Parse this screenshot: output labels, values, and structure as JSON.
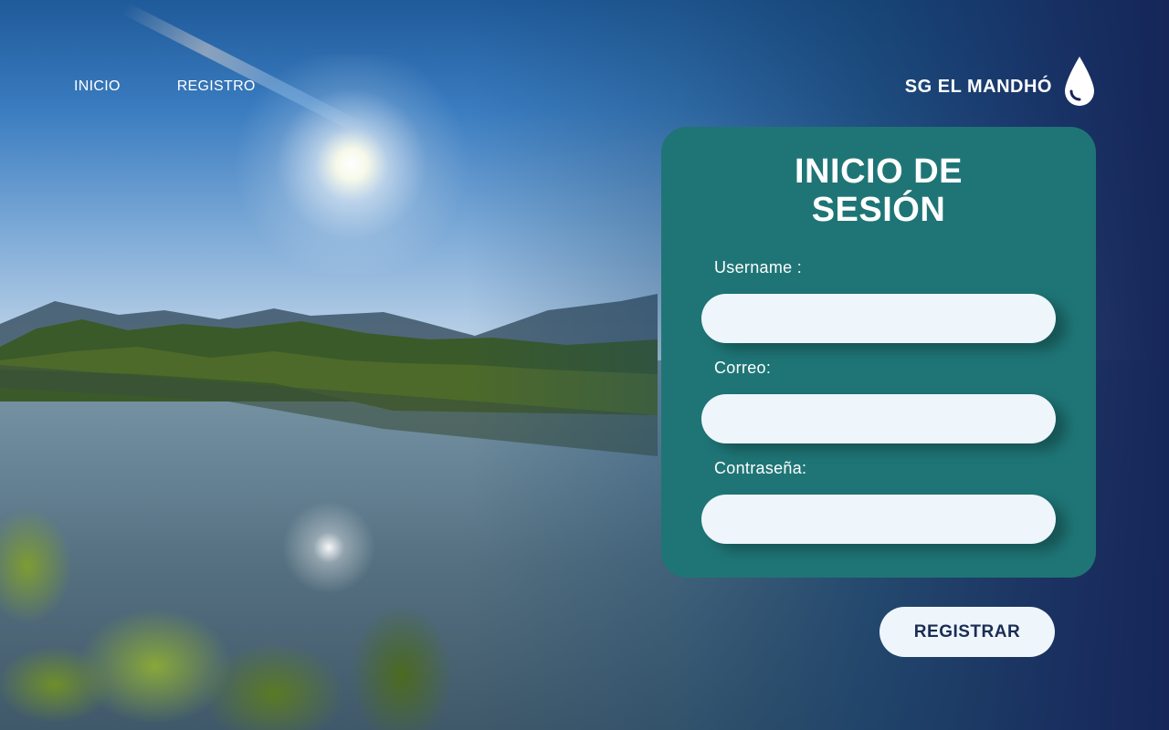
{
  "nav": {
    "items": [
      {
        "label": "INICIO"
      },
      {
        "label": "REGISTRO"
      }
    ]
  },
  "brand": {
    "name": "SG EL MANDHÓ",
    "icon": "water-drop-icon"
  },
  "form": {
    "title_line1": "INICIO DE",
    "title_line2": "SESIÓN",
    "fields": [
      {
        "label": "Username  :",
        "value": "",
        "placeholder": ""
      },
      {
        "label": "Correo:",
        "value": "",
        "placeholder": ""
      },
      {
        "label": "Contraseña:",
        "value": "",
        "placeholder": ""
      }
    ],
    "submit_label": "REGISTRAR"
  },
  "colors": {
    "card": "#1f7576",
    "input_bg": "#eef6fb",
    "button_text": "#1b2d55",
    "right_bg": "#162658"
  }
}
